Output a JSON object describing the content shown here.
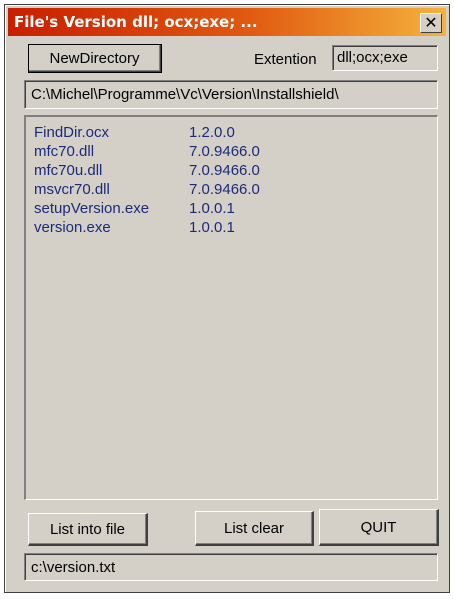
{
  "window": {
    "title": "File's Version  dll; ocx;exe; ...",
    "close_glyph": "✕"
  },
  "toolbar": {
    "new_directory_label": "NewDirectory",
    "extension_label": "Extention",
    "extension_value": "dll;ocx;exe"
  },
  "path": {
    "value": "C:\\Michel\\Programme\\Vc\\Version\\Installshield\\"
  },
  "files": [
    {
      "name": "FindDir.ocx",
      "version": "1.2.0.0"
    },
    {
      "name": "mfc70.dll",
      "version": "7.0.9466.0"
    },
    {
      "name": "mfc70u.dll",
      "version": "7.0.9466.0"
    },
    {
      "name": "msvcr70.dll",
      "version": "7.0.9466.0"
    },
    {
      "name": "setupVersion.exe",
      "version": "1.0.0.1"
    },
    {
      "name": "version.exe",
      "version": "1.0.0.1"
    }
  ],
  "buttons": {
    "list_into_file": "List into file",
    "list_clear": "List clear",
    "quit": "QUIT"
  },
  "output_file": {
    "value": "c:\\version.txt"
  }
}
